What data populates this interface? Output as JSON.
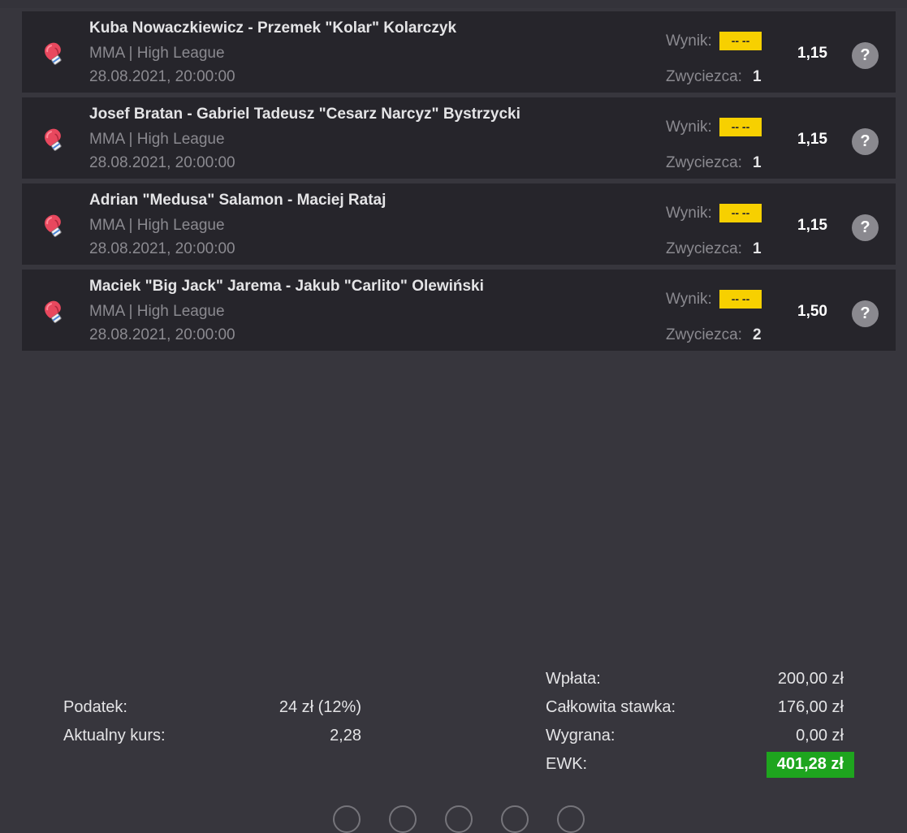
{
  "events": [
    {
      "title": "Kuba Nowaczkiewicz - Przemek \"Kolar\" Kolarczyk",
      "league": "MMA | High League",
      "date": "28.08.2021, 20:00:00",
      "result_label": "Wynik:",
      "result_value": "-- --",
      "winner_label": "Zwyciezca:",
      "winner_value": "1",
      "odds": "1,15",
      "help_label": "?",
      "icon": "boxing-glove-icon"
    },
    {
      "title": "Josef Bratan - Gabriel Tadeusz \"Cesarz Narcyz\" Bystrzycki",
      "league": "MMA | High League",
      "date": "28.08.2021, 20:00:00",
      "result_label": "Wynik:",
      "result_value": "-- --",
      "winner_label": "Zwyciezca:",
      "winner_value": "1",
      "odds": "1,15",
      "help_label": "?",
      "icon": "boxing-glove-icon"
    },
    {
      "title": "Adrian \"Medusa\" Salamon - Maciej Rataj",
      "league": "MMA | High League",
      "date": "28.08.2021, 20:00:00",
      "result_label": "Wynik:",
      "result_value": "-- --",
      "winner_label": "Zwyciezca:",
      "winner_value": "1",
      "odds": "1,15",
      "help_label": "?",
      "icon": "boxing-glove-icon"
    },
    {
      "title": "Maciek \"Big Jack\" Jarema - Jakub \"Carlito\" Olewiński",
      "league": "MMA | High League",
      "date": "28.08.2021, 20:00:00",
      "result_label": "Wynik:",
      "result_value": "-- --",
      "winner_label": "Zwyciezca:",
      "winner_value": "2",
      "odds": "1,50",
      "help_label": "?",
      "icon": "boxing-glove-icon"
    }
  ],
  "summary_left": {
    "tax_label": "Podatek:",
    "tax_value": "24 zł (12%)",
    "current_odds_label": "Aktualny kurs:",
    "current_odds_value": "2,28"
  },
  "summary_right": {
    "deposit_label": "Wpłata:",
    "deposit_value": "200,00 zł",
    "total_stake_label": "Całkowita stawka:",
    "total_stake_value": "176,00 zł",
    "win_label": "Wygrana:",
    "win_value": "0,00 zł",
    "ewk_label": "EWK:",
    "ewk_value": "401,28 zł"
  },
  "colors": {
    "background": "#37363d",
    "row_background": "#26252b",
    "result_badge": "#f7d000",
    "ewk_badge": "#1ea51e",
    "help_button": "#8a898f"
  }
}
